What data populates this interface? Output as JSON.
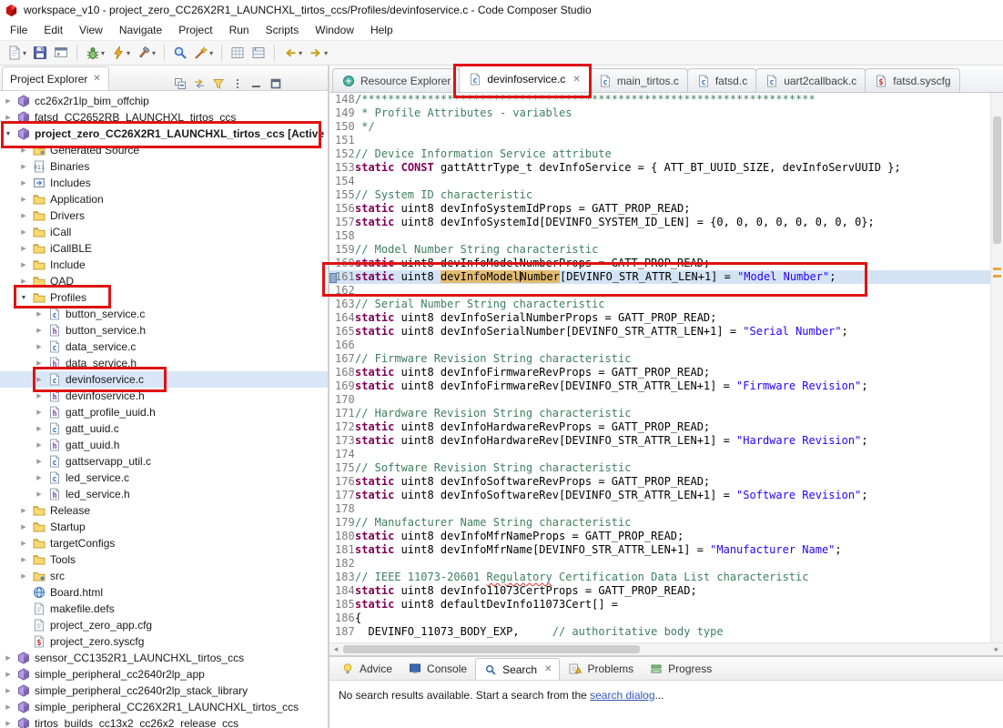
{
  "window": {
    "title": "workspace_v10 - project_zero_CC26X2R1_LAUNCHXL_tirtos_ccs/Profiles/devinfoservice.c - Code Composer Studio"
  },
  "menubar": [
    "File",
    "Edit",
    "View",
    "Navigate",
    "Project",
    "Run",
    "Scripts",
    "Window",
    "Help"
  ],
  "glyphs": {
    "close": "✕",
    "dropdown": "▾",
    "collapsed": "▶",
    "expanded": "▼",
    "hscroll_left": "◂",
    "hscroll_right": "▸"
  },
  "toolbar": {
    "items": [
      {
        "name": "new",
        "dropdown": true
      },
      {
        "name": "save"
      },
      {
        "name": "terminal"
      },
      {
        "type": "sep"
      },
      {
        "name": "debug",
        "dropdown": true
      },
      {
        "name": "flash",
        "dropdown": true
      },
      {
        "name": "build",
        "dropdown": true
      },
      {
        "type": "sep"
      },
      {
        "name": "search"
      },
      {
        "name": "analysis",
        "dropdown": true
      },
      {
        "type": "sep"
      },
      {
        "name": "memory"
      },
      {
        "name": "registers"
      },
      {
        "type": "sep"
      },
      {
        "name": "back",
        "dropdown": true
      },
      {
        "name": "forward",
        "dropdown": true
      }
    ]
  },
  "project_explorer": {
    "title": "Project Explorer",
    "toolbar_icons": [
      "collapse-all",
      "link-with-editor",
      "filter",
      "view-menu",
      "minimize",
      "maximize"
    ],
    "items": [
      {
        "label": "cc26x2r1lp_bim_offchip",
        "level": 0,
        "icon": "project",
        "arrow": "right"
      },
      {
        "label": "fatsd_CC2652RB_LAUNCHXL_tirtos_ccs",
        "level": 0,
        "icon": "project",
        "arrow": "right"
      },
      {
        "label": "project_zero_CC26X2R1_LAUNCHXL_tirtos_ccs [Active",
        "level": 0,
        "icon": "project",
        "arrow": "down",
        "bold": true
      },
      {
        "label": "Generated Source",
        "level": 1,
        "icon": "folder-gen",
        "arrow": "right"
      },
      {
        "label": "Binaries",
        "level": 1,
        "icon": "binaries",
        "arrow": "right"
      },
      {
        "label": "Includes",
        "level": 1,
        "icon": "includes",
        "arrow": "right"
      },
      {
        "label": "Application",
        "level": 1,
        "icon": "folder",
        "arrow": "right"
      },
      {
        "label": "Drivers",
        "level": 1,
        "icon": "folder",
        "arrow": "right"
      },
      {
        "label": "iCall",
        "level": 1,
        "icon": "folder",
        "arrow": "right"
      },
      {
        "label": "iCallBLE",
        "level": 1,
        "icon": "folder",
        "arrow": "right"
      },
      {
        "label": "Include",
        "level": 1,
        "icon": "folder",
        "arrow": "right"
      },
      {
        "label": "OAD",
        "level": 1,
        "icon": "folder",
        "arrow": "right"
      },
      {
        "label": "Profiles",
        "level": 1,
        "icon": "folder",
        "arrow": "down"
      },
      {
        "label": "button_service.c",
        "level": 2,
        "icon": "cfile",
        "arrow": "right"
      },
      {
        "label": "button_service.h",
        "level": 2,
        "icon": "hfile",
        "arrow": "right"
      },
      {
        "label": "data_service.c",
        "level": 2,
        "icon": "cfile",
        "arrow": "right"
      },
      {
        "label": "data_service.h",
        "level": 2,
        "icon": "hfile",
        "arrow": "right"
      },
      {
        "label": "devinfoservice.c",
        "level": 2,
        "icon": "cfile",
        "arrow": "right",
        "selected": true
      },
      {
        "label": "devinfoservice.h",
        "level": 2,
        "icon": "hfile",
        "arrow": "right"
      },
      {
        "label": "gatt_profile_uuid.h",
        "level": 2,
        "icon": "hfile",
        "arrow": "right"
      },
      {
        "label": "gatt_uuid.c",
        "level": 2,
        "icon": "cfile",
        "arrow": "right"
      },
      {
        "label": "gatt_uuid.h",
        "level": 2,
        "icon": "hfile",
        "arrow": "right"
      },
      {
        "label": "gattservapp_util.c",
        "level": 2,
        "icon": "cfile",
        "arrow": "right"
      },
      {
        "label": "led_service.c",
        "level": 2,
        "icon": "cfile",
        "arrow": "right"
      },
      {
        "label": "led_service.h",
        "level": 2,
        "icon": "hfile",
        "arrow": "right"
      },
      {
        "label": "Release",
        "level": 1,
        "icon": "folder",
        "arrow": "right"
      },
      {
        "label": "Startup",
        "level": 1,
        "icon": "folder",
        "arrow": "right"
      },
      {
        "label": "targetConfigs",
        "level": 1,
        "icon": "folder",
        "arrow": "right"
      },
      {
        "label": "Tools",
        "level": 1,
        "icon": "folder",
        "arrow": "right"
      },
      {
        "label": "src",
        "level": 1,
        "icon": "srcfolder",
        "arrow": "right"
      },
      {
        "label": "Board.html",
        "level": 1,
        "icon": "html",
        "arrow": "none"
      },
      {
        "label": "makefile.defs",
        "level": 1,
        "icon": "file",
        "arrow": "none"
      },
      {
        "label": "project_zero_app.cfg",
        "level": 1,
        "icon": "file",
        "arrow": "none"
      },
      {
        "label": "project_zero.syscfg",
        "level": 1,
        "icon": "syscfg",
        "arrow": "none"
      },
      {
        "label": "sensor_CC1352R1_LAUNCHXL_tirtos_ccs",
        "level": 0,
        "icon": "project",
        "arrow": "right"
      },
      {
        "label": "simple_peripheral_cc2640r2lp_app",
        "level": 0,
        "icon": "project",
        "arrow": "right"
      },
      {
        "label": "simple_peripheral_cc2640r2lp_stack_library",
        "level": 0,
        "icon": "project",
        "arrow": "right"
      },
      {
        "label": "simple_peripheral_CC26X2R1_LAUNCHXL_tirtos_ccs",
        "level": 0,
        "icon": "project",
        "arrow": "right"
      },
      {
        "label": "tirtos_builds_cc13x2_cc26x2_release_ccs",
        "level": 0,
        "icon": "project",
        "arrow": "right"
      }
    ]
  },
  "editor": {
    "tabs": [
      {
        "label": "Resource Explorer",
        "icon": "resource",
        "active": false
      },
      {
        "label": "devinfoservice.c",
        "icon": "cfile",
        "active": true,
        "close": true
      },
      {
        "label": "main_tirtos.c",
        "icon": "cfile",
        "active": false
      },
      {
        "label": "fatsd.c",
        "icon": "cfile",
        "active": false
      },
      {
        "label": "uart2callback.c",
        "icon": "cfile",
        "active": false
      },
      {
        "label": "fatsd.syscfg",
        "icon": "syscfg",
        "active": false
      }
    ],
    "lines": [
      {
        "n": 148,
        "seg": [
          [
            "c",
            "/*********************************************************************"
          ]
        ]
      },
      {
        "n": 149,
        "seg": [
          [
            "c",
            " * Profile Attributes - variables"
          ]
        ]
      },
      {
        "n": 150,
        "seg": [
          [
            "c",
            " */"
          ]
        ]
      },
      {
        "n": 151,
        "seg": []
      },
      {
        "n": 152,
        "seg": [
          [
            "c",
            "// Device Information Service attribute"
          ]
        ]
      },
      {
        "n": 153,
        "seg": [
          [
            "k",
            "static"
          ],
          [
            "p",
            " "
          ],
          [
            "k",
            "CONST"
          ],
          [
            "p",
            " gattAttrType_t devInfoService = { ATT_BT_UUID_SIZE, devInfoServUUID };"
          ]
        ]
      },
      {
        "n": 154,
        "seg": []
      },
      {
        "n": 155,
        "seg": [
          [
            "c",
            "// System ID characteristic"
          ]
        ]
      },
      {
        "n": 156,
        "seg": [
          [
            "k",
            "static"
          ],
          [
            "p",
            " uint8 devInfoSystemIdProps = GATT_PROP_READ;"
          ]
        ]
      },
      {
        "n": 157,
        "seg": [
          [
            "k",
            "static"
          ],
          [
            "p",
            " uint8 devInfoSystemId[DEVINFO_SYSTEM_ID_LEN] = {0, 0, 0, 0, 0, 0, 0, 0};"
          ]
        ]
      },
      {
        "n": 158,
        "seg": []
      },
      {
        "n": 159,
        "seg": [
          [
            "c",
            "// Model Number String characteristic"
          ]
        ]
      },
      {
        "n": 160,
        "seg": [
          [
            "k",
            "static"
          ],
          [
            "p",
            " uint8 devInfoModelNumberProps = GATT_PROP_READ;"
          ]
        ]
      },
      {
        "n": 161,
        "current": true,
        "seg": [
          [
            "k",
            "static"
          ],
          [
            "p",
            " uint8 "
          ],
          [
            "h",
            "devInfoModel"
          ],
          [
            "cur",
            ""
          ],
          [
            "h",
            "Number"
          ],
          [
            "p",
            "[DEVINFO_STR_ATTR_LEN+1] = "
          ],
          [
            "s",
            "\"Model Number\""
          ],
          [
            "p",
            ";"
          ]
        ]
      },
      {
        "n": 162,
        "seg": []
      },
      {
        "n": 163,
        "seg": [
          [
            "c",
            "// Serial Number String characteristic"
          ]
        ]
      },
      {
        "n": 164,
        "seg": [
          [
            "k",
            "static"
          ],
          [
            "p",
            " uint8 devInfoSerialNumberProps = GATT_PROP_READ;"
          ]
        ]
      },
      {
        "n": 165,
        "seg": [
          [
            "k",
            "static"
          ],
          [
            "p",
            " uint8 devInfoSerialNumber[DEVINFO_STR_ATTR_LEN+1] = "
          ],
          [
            "s",
            "\"Serial Number\""
          ],
          [
            "p",
            ";"
          ]
        ]
      },
      {
        "n": 166,
        "seg": []
      },
      {
        "n": 167,
        "seg": [
          [
            "c",
            "// Firmware Revision String characteristic"
          ]
        ]
      },
      {
        "n": 168,
        "seg": [
          [
            "k",
            "static"
          ],
          [
            "p",
            " uint8 devInfoFirmwareRevProps = GATT_PROP_READ;"
          ]
        ]
      },
      {
        "n": 169,
        "seg": [
          [
            "k",
            "static"
          ],
          [
            "p",
            " uint8 devInfoFirmwareRev[DEVINFO_STR_ATTR_LEN+1] = "
          ],
          [
            "s",
            "\"Firmware Revision\""
          ],
          [
            "p",
            ";"
          ]
        ]
      },
      {
        "n": 170,
        "seg": []
      },
      {
        "n": 171,
        "seg": [
          [
            "c",
            "// Hardware Revision String characteristic"
          ]
        ]
      },
      {
        "n": 172,
        "seg": [
          [
            "k",
            "static"
          ],
          [
            "p",
            " uint8 devInfoHardwareRevProps = GATT_PROP_READ;"
          ]
        ]
      },
      {
        "n": 173,
        "seg": [
          [
            "k",
            "static"
          ],
          [
            "p",
            " uint8 devInfoHardwareRev[DEVINFO_STR_ATTR_LEN+1] = "
          ],
          [
            "s",
            "\"Hardware Revision\""
          ],
          [
            "p",
            ";"
          ]
        ]
      },
      {
        "n": 174,
        "seg": []
      },
      {
        "n": 175,
        "seg": [
          [
            "c",
            "// Software Revision String characteristic"
          ]
        ]
      },
      {
        "n": 176,
        "seg": [
          [
            "k",
            "static"
          ],
          [
            "p",
            " uint8 devInfoSoftwareRevProps = GATT_PROP_READ;"
          ]
        ]
      },
      {
        "n": 177,
        "seg": [
          [
            "k",
            "static"
          ],
          [
            "p",
            " uint8 devInfoSoftwareRev[DEVINFO_STR_ATTR_LEN+1] = "
          ],
          [
            "s",
            "\"Software Revision\""
          ],
          [
            "p",
            ";"
          ]
        ]
      },
      {
        "n": 178,
        "seg": []
      },
      {
        "n": 179,
        "seg": [
          [
            "c",
            "// Manufacturer Name String characteristic"
          ]
        ]
      },
      {
        "n": 180,
        "seg": [
          [
            "k",
            "static"
          ],
          [
            "p",
            " uint8 devInfoMfrNameProps = GATT_PROP_READ;"
          ]
        ]
      },
      {
        "n": 181,
        "seg": [
          [
            "k",
            "static"
          ],
          [
            "p",
            " uint8 devInfoMfrName[DEVINFO_STR_ATTR_LEN+1] = "
          ],
          [
            "s",
            "\"Manufacturer Name\""
          ],
          [
            "p",
            ";"
          ]
        ]
      },
      {
        "n": 182,
        "seg": []
      },
      {
        "n": 183,
        "seg": [
          [
            "c",
            "// IEEE 11073-20601 "
          ],
          [
            "w",
            "Regulatory"
          ],
          [
            "c",
            " Certification Data List characteristic"
          ]
        ]
      },
      {
        "n": 184,
        "seg": [
          [
            "k",
            "static"
          ],
          [
            "p",
            " uint8 devInfo11073CertProps = GATT_PROP_READ;"
          ]
        ]
      },
      {
        "n": 185,
        "seg": [
          [
            "k",
            "static"
          ],
          [
            "p",
            " uint8 defaultDevInfo11073Cert[] ="
          ]
        ]
      },
      {
        "n": 186,
        "seg": [
          [
            "p",
            "{"
          ]
        ]
      },
      {
        "n": 187,
        "seg": [
          [
            "p",
            "  DEVINFO_11073_BODY_EXP,     "
          ],
          [
            "c",
            "// authoritative body type"
          ]
        ]
      }
    ]
  },
  "bottom_panel": {
    "tabs": [
      {
        "label": "Advice",
        "icon": "advice"
      },
      {
        "label": "Console",
        "icon": "console"
      },
      {
        "label": "Search",
        "icon": "searchtab",
        "active": true,
        "close": true
      },
      {
        "label": "Problems",
        "icon": "problems"
      },
      {
        "label": "Progress",
        "icon": "progress"
      }
    ],
    "search_message": {
      "prefix": "No search results available. Start a search from the ",
      "link": "search dialog",
      "suffix": "..."
    }
  }
}
